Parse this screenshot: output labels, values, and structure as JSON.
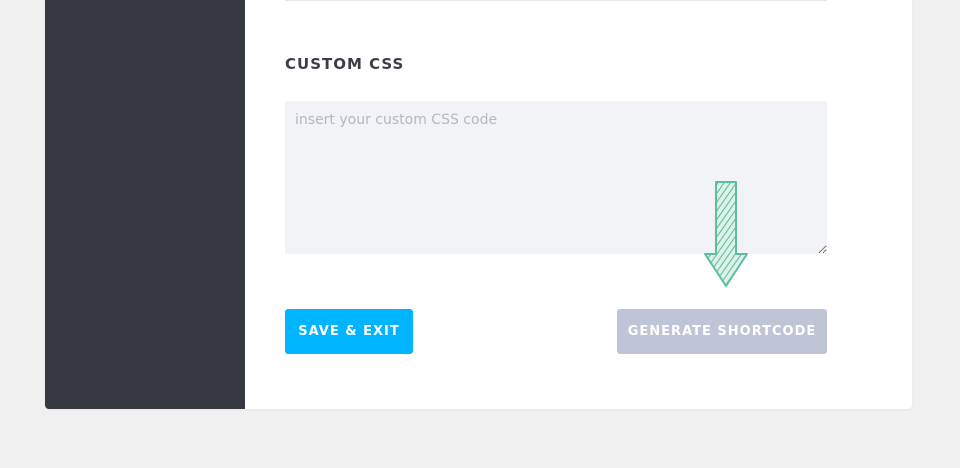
{
  "custom_css": {
    "title": "CUSTOM CSS",
    "placeholder": "insert your custom CSS code",
    "value": ""
  },
  "buttons": {
    "save_exit": "SAVE & EXIT",
    "generate_shortcode": "GENERATE SHORTCODE"
  },
  "hint": {
    "icon": "arrow-down-icon",
    "color": "#5dbf9a"
  },
  "colors": {
    "sidebar": "#363942",
    "save_button": "#00b4ff",
    "generate_button": "#bfc4d6",
    "textarea_bg": "#f2f3f7",
    "page_bg": "#f0f0f0"
  }
}
